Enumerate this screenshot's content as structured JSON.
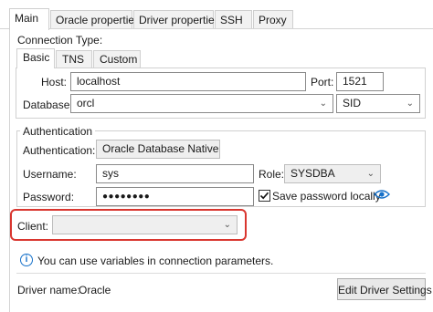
{
  "tabs": [
    "Main",
    "Oracle properties",
    "Driver properties",
    "SSH",
    "Proxy"
  ],
  "connection_type_label": "Connection Type:",
  "inner_tabs": [
    "Basic",
    "TNS",
    "Custom"
  ],
  "host": {
    "label": "Host:",
    "value": "localhost"
  },
  "port": {
    "label": "Port:",
    "value": "1521"
  },
  "database": {
    "label": "Database:",
    "value": "orcl",
    "type": "SID"
  },
  "authentication": {
    "group_title": "Authentication",
    "label": "Authentication:",
    "value": "Oracle Database Native",
    "username_label": "Username:",
    "username": "sys",
    "role_label": "Role:",
    "role": "SYSDBA",
    "password_label": "Password:",
    "password": "●●●●●●●●",
    "save_password_label": "Save password locally",
    "save_password_checked": true
  },
  "client": {
    "label": "Client:",
    "value": ""
  },
  "info_text": "You can use variables in connection parameters.",
  "driver": {
    "label": "Driver name:",
    "value": "Oracle",
    "edit_button": "Edit Driver Settings"
  },
  "colors": {
    "highlight": "#d9362f",
    "accent": "#1570c9"
  }
}
